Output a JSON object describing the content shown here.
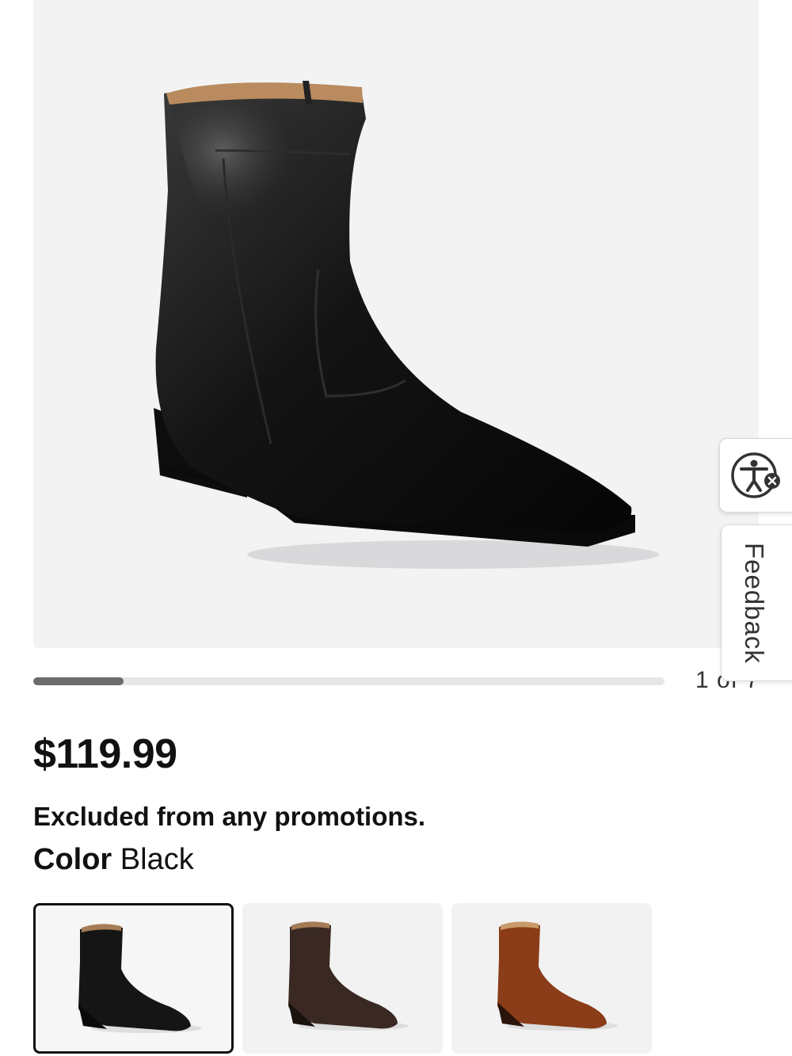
{
  "product": {
    "main_image_icon": "black-zip-boot-image",
    "price": "$119.99",
    "promo_note": "Excluded from any promotions.",
    "color_label": "Color",
    "color_value": "Black"
  },
  "gallery": {
    "counter": "1 of 7",
    "progress_fraction": 0.143
  },
  "widgets": {
    "accessibility_icon": "accessibility-icon",
    "feedback_label": "Feedback"
  },
  "swatches": [
    {
      "name": "Black",
      "icon": "black-boot-thumbnail",
      "selected": true,
      "color": "#1a1a1a"
    },
    {
      "name": "Brown",
      "icon": "dark-brown-boot-thumbnail",
      "selected": false,
      "color": "#3d2a22"
    },
    {
      "name": "Cognac",
      "icon": "cognac-boot-thumbnail",
      "selected": false,
      "color": "#8a3c17"
    }
  ],
  "colors": {
    "image_bg": "#f3f3f4",
    "progress_fill": "#6b6b6b",
    "progress_track": "#e6e6e6"
  }
}
